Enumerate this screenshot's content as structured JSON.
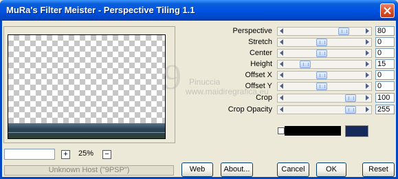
{
  "window": {
    "title": "MuRa's Filter Meister - Perspective Tiling 1.1"
  },
  "params": [
    {
      "label": "Perspective",
      "value": "80",
      "position": 0.78
    },
    {
      "label": "Stretch",
      "value": "0",
      "position": 0.45
    },
    {
      "label": "Center",
      "value": "0",
      "position": 0.45
    },
    {
      "label": "Height",
      "value": "15",
      "position": 0.2
    },
    {
      "label": "Offset X",
      "value": "0",
      "position": 0.45
    },
    {
      "label": "Offset Y",
      "value": "0",
      "position": 0.45
    },
    {
      "label": "Crop",
      "value": "100",
      "position": 0.88
    },
    {
      "label": "Crop Opacity",
      "value": "255",
      "position": 0.88
    }
  ],
  "zoom": {
    "value": "25%",
    "plus": "+",
    "minus": "−"
  },
  "status": "Unknown Host (\"9PSP\")",
  "buttons": {
    "web": "Web",
    "about": "About...",
    "cancel": "Cancel",
    "ok": "OK",
    "reset": "Reset"
  },
  "colors": {
    "swatch_left": "#ffffff",
    "swatch_middle": "#000000",
    "swatch_right": "#152a5a"
  },
  "watermark": {
    "line1": "Pinuccia",
    "line2": "www.maidiregrafica.eu"
  }
}
